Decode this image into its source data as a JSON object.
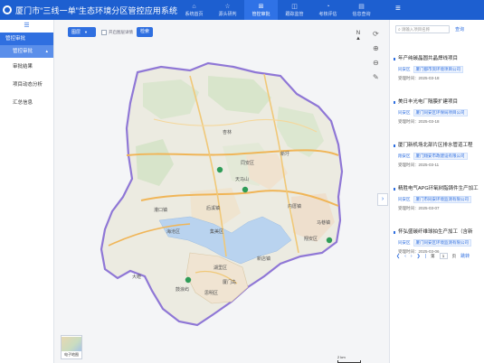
{
  "app": {
    "title": "厦门市“三线一单”生态环境分区管控应用系统"
  },
  "nav": [
    {
      "label": "系统首页",
      "icon": "home-icon",
      "glyph": "⌂"
    },
    {
      "label": "源头研判",
      "icon": "star-icon",
      "glyph": "☆"
    },
    {
      "label": "管控审批",
      "icon": "stamp-icon",
      "glyph": "⊞"
    },
    {
      "label": "跟踪监管",
      "icon": "monitor-icon",
      "glyph": "◫"
    },
    {
      "label": "考核评估",
      "icon": "chart-icon",
      "glyph": "◔"
    },
    {
      "label": "信息查询",
      "icon": "document-icon",
      "glyph": "▤"
    }
  ],
  "sidebar": {
    "group": "管控审批",
    "sub": "管控审批",
    "items": [
      "审批结果",
      "项目动态分析",
      "汇总信息"
    ]
  },
  "map": {
    "select_label": "图层",
    "checkbox_label": "开启图层详情",
    "search_label": "检索",
    "compass": "N",
    "basemap_label": "电子地图",
    "scale_label": "2 km",
    "places": [
      "杏林",
      "天马山",
      "灌口镇",
      "内厝镇",
      "马巷镇",
      "新圩",
      "海沧区",
      "集美区",
      "同安区",
      "翔安区",
      "湖里区",
      "思明区",
      "厦门岛",
      "大嶝",
      "鼓浪屿",
      "后溪镇",
      "新店镇"
    ]
  },
  "panel": {
    "search_placeholder": "请输入项目名称",
    "reset_label": "查询",
    "projects": [
      {
        "title": "年产纯碳晶圆共晶焊线项目",
        "district": "同安区",
        "org": "厦门都市资环境项目公司",
        "time": "受理时间：2025-03-18"
      },
      {
        "title": "美日丰光电厂隔膜扩建项目",
        "district": "同安区",
        "org": "厦门同安区环保局项目公司",
        "time": "受理时间：2025-03-18"
      },
      {
        "title": "厦门新机场北部片区排水管道工程",
        "district": "翔安区",
        "org": "厦门翔安市政建设有限公司",
        "time": "受理时间：2025-03-11"
      },
      {
        "title": "精胜电气APG环氧树脂铸件生产加工",
        "district": "同安区",
        "org": "厦门市同安环境监测有限公司",
        "time": "受理时间：2025-03-07"
      },
      {
        "title": "怀弘盛碳纤维球拍生产加工（含新",
        "district": "同安区",
        "org": "厦门同安区环境监测有限公司",
        "time": "受理时间：2025-03-06"
      }
    ],
    "pager": {
      "page": "1",
      "of_label": "页",
      "goto_label": "跳转"
    }
  },
  "colors": {
    "brand": "#1d5fd0",
    "accent": "#2f6fe0",
    "boundary": "#8f77d6"
  }
}
